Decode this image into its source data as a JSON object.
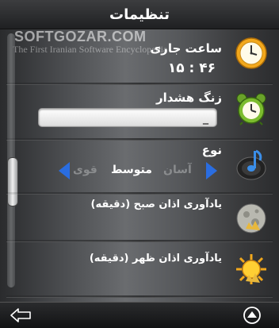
{
  "header": {
    "title": "تنظیمات"
  },
  "watermark": {
    "brand": "SOFTGOZAR.COM",
    "tagline": "The First Iranian Software Encyclopedia"
  },
  "settings": {
    "clock": {
      "label": "ساعت جاری",
      "value": "۱۵ : ۴۶"
    },
    "alarm": {
      "label": "زنگ هشدار",
      "value": "_"
    },
    "type": {
      "label": "نوع",
      "options": [
        "آسان",
        "متوسط",
        "قوی"
      ],
      "selected": "متوسط"
    },
    "dawn": {
      "label": "یادآوری اذان صبح (دقیقه)"
    },
    "noon": {
      "label": "یادآوری اذان ظهر (دقیقه)"
    }
  },
  "icons": {
    "clock": "clock-icon",
    "alarm": "alarm-clock-icon",
    "type": "music-note-icon",
    "dawn": "moon-icon",
    "noon": "sun-icon",
    "back": "back-arrow-icon",
    "menu": "up-arrow-circle-icon"
  },
  "colors": {
    "accent": "#2a6de0",
    "clock_face": "#f2a81c"
  }
}
